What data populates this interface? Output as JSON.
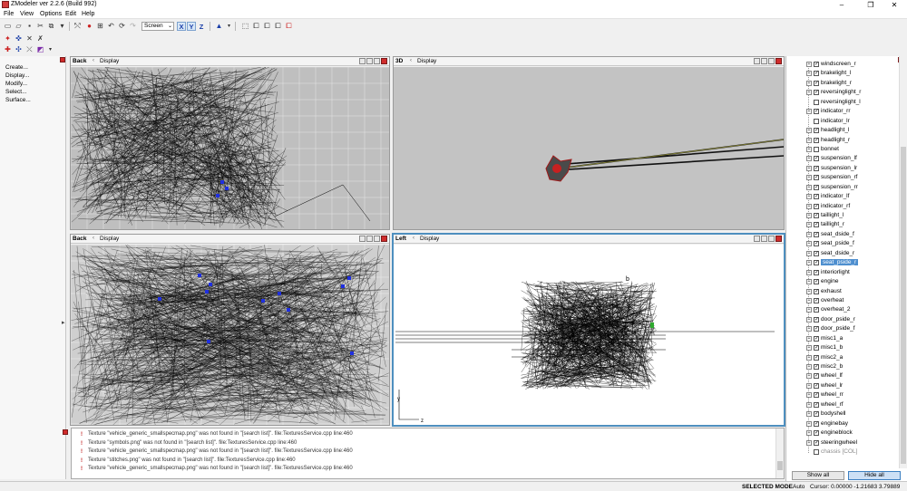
{
  "window": {
    "title": "ZModeler ver 2.2.6 (Build 992)",
    "minimize": "–",
    "maximize": "❐",
    "close": "✕"
  },
  "menubar": [
    "File",
    "View",
    "Options",
    "Edit",
    "Help"
  ],
  "toolbar": {
    "coord_system": "Screen",
    "axes": [
      {
        "label": "X",
        "active": true
      },
      {
        "label": "Y",
        "active": true
      },
      {
        "label": "Z",
        "active": false
      }
    ]
  },
  "left_panel": {
    "items": [
      "Create...",
      "Display...",
      "Modify...",
      "Select...",
      "Surface..."
    ]
  },
  "viewports": [
    {
      "name": "Back",
      "menu": "Display",
      "active": false
    },
    {
      "name": "3D",
      "menu": "Display",
      "active": false
    },
    {
      "name": "Back",
      "menu": "Display",
      "active": false
    },
    {
      "name": "Left",
      "menu": "Display",
      "active": true
    }
  ],
  "viewport_axes": {
    "y": "y",
    "z": "z"
  },
  "viewport_cursor": "b",
  "object_tree": [
    {
      "label": "windscreen_r",
      "checked": true,
      "expandable": true
    },
    {
      "label": "brakelight_l",
      "checked": true,
      "expandable": true
    },
    {
      "label": "brakelight_r",
      "checked": true,
      "expandable": true
    },
    {
      "label": "reversinglight_r",
      "checked": true,
      "expandable": true
    },
    {
      "label": "reversinglight_l",
      "checked": false,
      "expandable": false
    },
    {
      "label": "indicator_rr",
      "checked": true,
      "expandable": true
    },
    {
      "label": "indicator_lr",
      "checked": false,
      "expandable": false
    },
    {
      "label": "headlight_l",
      "checked": true,
      "expandable": true
    },
    {
      "label": "headlight_r",
      "checked": true,
      "expandable": true
    },
    {
      "label": "bonnet",
      "checked": false,
      "expandable": true
    },
    {
      "label": "suspension_lf",
      "checked": true,
      "expandable": true
    },
    {
      "label": "suspension_lr",
      "checked": true,
      "expandable": true
    },
    {
      "label": "suspension_rf",
      "checked": true,
      "expandable": true
    },
    {
      "label": "suspension_rr",
      "checked": true,
      "expandable": true
    },
    {
      "label": "indicator_lf",
      "checked": true,
      "expandable": true
    },
    {
      "label": "indicator_rf",
      "checked": true,
      "expandable": true
    },
    {
      "label": "taillight_l",
      "checked": true,
      "expandable": true
    },
    {
      "label": "taillight_r",
      "checked": true,
      "expandable": true
    },
    {
      "label": "seat_dside_f",
      "checked": true,
      "expandable": true
    },
    {
      "label": "seat_pside_f",
      "checked": true,
      "expandable": true
    },
    {
      "label": "seat_dside_r",
      "checked": true,
      "expandable": true
    },
    {
      "label": "seat_pside_r",
      "checked": true,
      "expandable": true,
      "selected": true
    },
    {
      "label": "interiorlight",
      "checked": true,
      "expandable": true
    },
    {
      "label": "engine",
      "checked": true,
      "expandable": true
    },
    {
      "label": "exhaust",
      "checked": true,
      "expandable": true
    },
    {
      "label": "overheat",
      "checked": true,
      "expandable": true
    },
    {
      "label": "overheat_2",
      "checked": true,
      "expandable": true
    },
    {
      "label": "door_pside_r",
      "checked": true,
      "expandable": true
    },
    {
      "label": "door_pside_f",
      "checked": true,
      "expandable": true
    },
    {
      "label": "misc1_a",
      "checked": true,
      "expandable": true
    },
    {
      "label": "misc1_b",
      "checked": true,
      "expandable": true
    },
    {
      "label": "misc2_a",
      "checked": true,
      "expandable": true
    },
    {
      "label": "misc2_b",
      "checked": true,
      "expandable": true
    },
    {
      "label": "wheel_lf",
      "checked": true,
      "expandable": true
    },
    {
      "label": "wheel_lr",
      "checked": true,
      "expandable": true
    },
    {
      "label": "wheel_rr",
      "checked": true,
      "expandable": true
    },
    {
      "label": "wheel_rf",
      "checked": true,
      "expandable": true
    },
    {
      "label": "bodyshell",
      "checked": true,
      "expandable": true
    },
    {
      "label": "enginebay",
      "checked": true,
      "expandable": true
    },
    {
      "label": "engineblock",
      "checked": true,
      "expandable": true
    },
    {
      "label": "steeringwheel",
      "checked": true,
      "expandable": true
    },
    {
      "label": "chassis [COL]",
      "checked": false,
      "expandable": false,
      "disabled": true
    }
  ],
  "tree_buttons": {
    "show_all": "Show all",
    "hide_all": "Hide all"
  },
  "log": [
    "Texture \"vehicle_generic_smallspecmap.png\" was not found in \"[search list]\". file:TexturesService.cpp line:460",
    "Texture \"symbols.png\" was not found in \"[search list]\". file:TexturesService.cpp line:460",
    "Texture \"vehicle_generic_smallspecmap.png\" was not found in \"[search list]\". file:TexturesService.cpp line:460",
    "Texture \"stitches.png\" was not found in \"[search list]\". file:TexturesService.cpp line:460",
    "Texture \"vehicle_generic_smallspecmap.png\" was not found in \"[search list]\". file:TexturesService.cpp line:460"
  ],
  "status": {
    "mode": "SELECTED MODE",
    "snap": "Auto",
    "cursor": "Cursor: 0.00000 -1.21683 3.79889"
  },
  "colors": {
    "accent": "#4e8fbf",
    "close_red": "#cf2c2c",
    "selection": "#4e8fcf",
    "wire": "#000000",
    "marker_blue": "#1f2fe0"
  }
}
